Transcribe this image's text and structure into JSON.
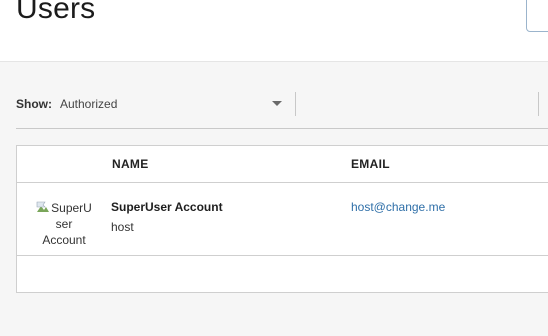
{
  "header": {
    "title": "Users"
  },
  "filter": {
    "show_label": "Show:",
    "show_value": "Authorized"
  },
  "table": {
    "columns": [
      "NAME",
      "EMAIL"
    ],
    "rows": [
      {
        "avatar_alt_line1": "SuperU",
        "avatar_alt_line2": "ser",
        "avatar_alt_line3": "Account",
        "display_name": "SuperUser Account",
        "username": "host",
        "email": "host@change.me"
      }
    ]
  },
  "colors": {
    "link": "#2f6fa8",
    "border": "#cfcfcf",
    "background": "#f6f6f6"
  }
}
